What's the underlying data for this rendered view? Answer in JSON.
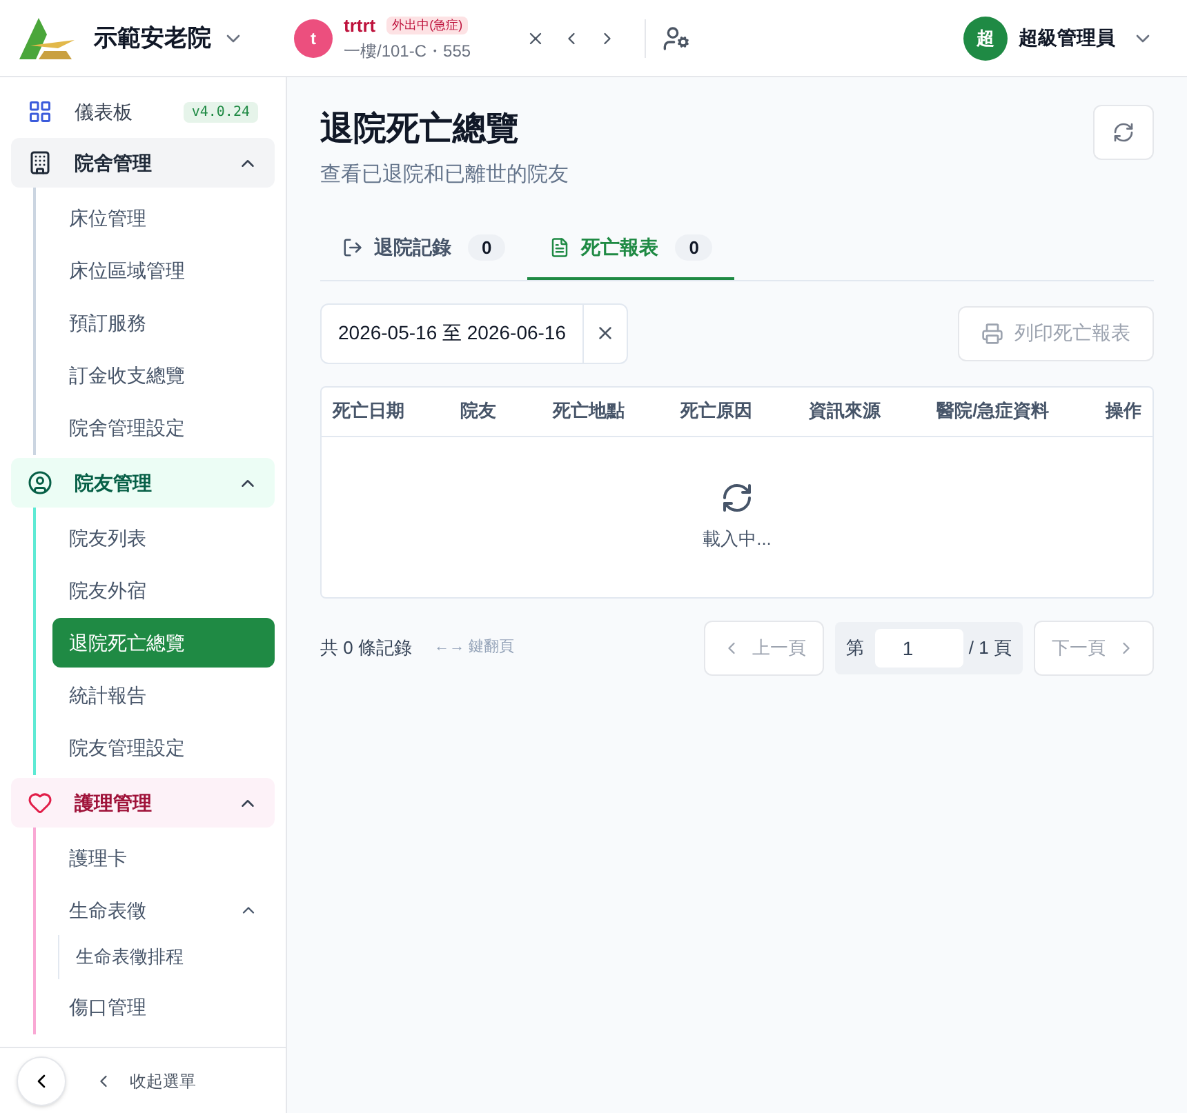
{
  "header": {
    "org_name": "示範安老院",
    "resident": {
      "avatar": "t",
      "name": "trtrt",
      "status": "外出中(急症)",
      "location": "一樓/101-C・555"
    },
    "user": {
      "avatar": "超",
      "name": "超級管理員"
    }
  },
  "sidebar": {
    "dashboard": {
      "label": "儀表板",
      "version": "v4.0.24"
    },
    "groups": [
      {
        "label": "院舍管理",
        "kind": "building",
        "color": "#1f2937",
        "expanded": true,
        "items": [
          {
            "label": "床位管理",
            "selected": false
          },
          {
            "label": "床位區域管理",
            "selected": false
          },
          {
            "label": "預訂服務",
            "selected": false
          },
          {
            "label": "訂金收支總覽",
            "selected": false
          },
          {
            "label": "院舍管理設定",
            "selected": false
          }
        ]
      },
      {
        "label": "院友管理",
        "kind": "person",
        "color": "#065f46",
        "expanded": true,
        "items": [
          {
            "label": "院友列表",
            "selected": false
          },
          {
            "label": "院友外宿",
            "selected": false
          },
          {
            "label": "退院死亡總覽",
            "selected": true
          },
          {
            "label": "統計報告",
            "selected": false
          },
          {
            "label": "院友管理設定",
            "selected": false
          }
        ]
      },
      {
        "label": "護理管理",
        "kind": "heart",
        "color": "#9f1239",
        "expanded": true,
        "items": [
          {
            "label": "護理卡",
            "selected": false
          },
          {
            "label": "生命表徵",
            "selected": false,
            "expanded": true,
            "children": [
              {
                "label": "生命表徵排程",
                "selected": false
              }
            ]
          },
          {
            "label": "傷口管理",
            "selected": false
          }
        ]
      }
    ],
    "collapse_label": "收起選單"
  },
  "page": {
    "title": "退院死亡總覽",
    "subtitle": "查看已退院和已離世的院友",
    "tabs": [
      {
        "label": "退院記錄",
        "count": "0",
        "kind": "exit",
        "selected": false
      },
      {
        "label": "死亡報表",
        "count": "0",
        "kind": "document",
        "selected": true
      }
    ],
    "date_range": "2026-05-16 至 2026-06-16",
    "print_button": "列印死亡報表",
    "table": {
      "columns": [
        "死亡日期",
        "院友",
        "死亡地點",
        "死亡原因",
        "資訊來源",
        "醫院/急症資料",
        "操作"
      ],
      "loading_text": "載入中..."
    },
    "footer": {
      "total": "共 0 條記錄",
      "hint": "←→ 鍵翻頁",
      "prev": "上一頁",
      "page_prefix": "第",
      "page_value": "1",
      "page_suffix": "/ 1 頁",
      "next": "下一頁"
    }
  }
}
